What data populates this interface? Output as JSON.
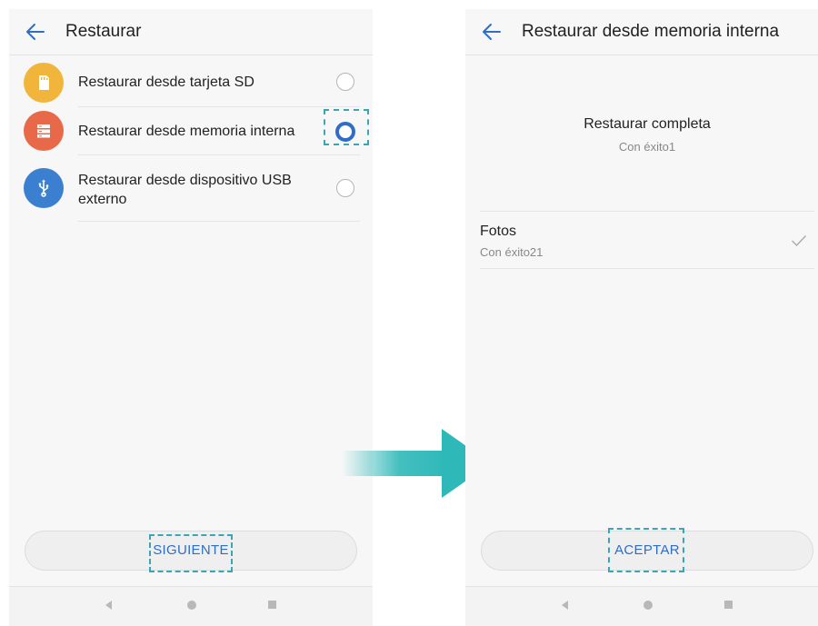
{
  "left_screen": {
    "title": "Restaurar",
    "options": [
      {
        "label": "Restaurar desde tarjeta SD",
        "icon": "sd-card-icon",
        "color": "#f2b53c",
        "selected": false
      },
      {
        "label": "Restaurar desde memoria interna",
        "icon": "storage-icon",
        "color": "#e8694a",
        "selected": true
      },
      {
        "label": "Restaurar desde dispositivo USB externo",
        "icon": "usb-icon",
        "color": "#3a7fd0",
        "selected": false
      }
    ],
    "button_label": "SIGUIENTE"
  },
  "right_screen": {
    "title": "Restaurar desde memoria interna",
    "status_title": "Restaurar completa",
    "status_subtitle": "Con éxito1",
    "item_title": "Fotos",
    "item_subtitle": "Con éxito21",
    "button_label": "ACEPTAR"
  },
  "colors": {
    "accent": "#2f6dc6",
    "highlight": "#3aa6b3",
    "arrow": "#2fb8b8"
  }
}
